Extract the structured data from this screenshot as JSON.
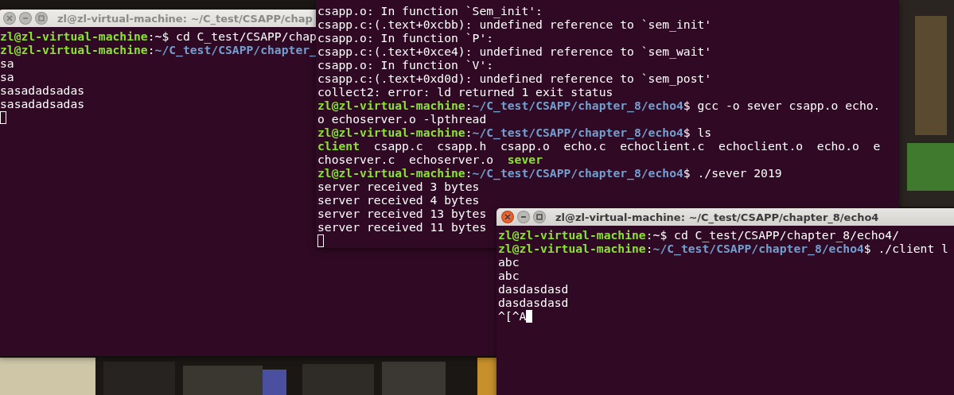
{
  "windows": [
    {
      "title": "zl@zl-virtual-machine: ~/C_test/CSAPP/chap",
      "focused": false,
      "lines": [
        {
          "kind": "output",
          "segments": [
            {
              "kind": "host",
              "text": "zl@zl-virtual-machine"
            },
            {
              "kind": "text",
              "text": ":~$ cd C_test/CSAPP/chap"
            }
          ]
        },
        {
          "kind": "output",
          "segments": [
            {
              "kind": "host",
              "text": "zl@zl-virtual-machine"
            },
            {
              "kind": "text",
              "text": ":"
            },
            {
              "kind": "path",
              "text": "~/C_test/CSAPP/chapter_"
            }
          ]
        },
        {
          "kind": "output",
          "segments": [
            {
              "kind": "text",
              "text": "sa"
            }
          ]
        },
        {
          "kind": "output",
          "segments": [
            {
              "kind": "text",
              "text": "sa"
            }
          ]
        },
        {
          "kind": "output",
          "segments": [
            {
              "kind": "text",
              "text": "sasadadsadas"
            }
          ]
        },
        {
          "kind": "output",
          "segments": [
            {
              "kind": "text",
              "text": "sasadadsadas"
            }
          ]
        },
        {
          "kind": "input"
        }
      ]
    },
    {
      "focused": false,
      "lines": [
        {
          "kind": "output",
          "segments": [
            {
              "kind": "text",
              "text": "csapp.o: In function `Sem_init':"
            }
          ]
        },
        {
          "kind": "output",
          "segments": [
            {
              "kind": "text",
              "text": "csapp.c:(.text+0xcbb): undefined reference to `sem_init'"
            }
          ]
        },
        {
          "kind": "output",
          "segments": [
            {
              "kind": "text",
              "text": "csapp.o: In function `P':"
            }
          ]
        },
        {
          "kind": "output",
          "segments": [
            {
              "kind": "text",
              "text": "csapp.c:(.text+0xce4): undefined reference to `sem_wait'"
            }
          ]
        },
        {
          "kind": "output",
          "segments": [
            {
              "kind": "text",
              "text": "csapp.o: In function `V':"
            }
          ]
        },
        {
          "kind": "output",
          "segments": [
            {
              "kind": "text",
              "text": "csapp.c:(.text+0xd0d): undefined reference to `sem_post'"
            }
          ]
        },
        {
          "kind": "output",
          "segments": [
            {
              "kind": "text",
              "text": "collect2: error: ld returned 1 exit status"
            }
          ]
        },
        {
          "kind": "output",
          "segments": [
            {
              "kind": "host",
              "text": "zl@zl-virtual-machine"
            },
            {
              "kind": "text",
              "text": ":"
            },
            {
              "kind": "path",
              "text": "~/C_test/CSAPP/chapter_8/echo4"
            },
            {
              "kind": "text",
              "text": "$ gcc -o sever csapp.o echo."
            }
          ]
        },
        {
          "kind": "output",
          "segments": [
            {
              "kind": "text",
              "text": "o echoserver.o -lpthread"
            }
          ]
        },
        {
          "kind": "output",
          "segments": [
            {
              "kind": "host",
              "text": "zl@zl-virtual-machine"
            },
            {
              "kind": "text",
              "text": ":"
            },
            {
              "kind": "path",
              "text": "~/C_test/CSAPP/chapter_8/echo4"
            },
            {
              "kind": "text",
              "text": "$ ls"
            }
          ]
        },
        {
          "kind": "output",
          "segments": [
            {
              "kind": "exec",
              "text": "client"
            },
            {
              "kind": "text",
              "text": "  csapp.c  csapp.h  csapp.o  echo.c  echoclient.c  echoclient.o  echo.o  e"
            }
          ]
        },
        {
          "kind": "output",
          "segments": [
            {
              "kind": "text",
              "text": "choserver.c  echoserver.o  "
            },
            {
              "kind": "exec",
              "text": "sever"
            }
          ]
        },
        {
          "kind": "output",
          "segments": [
            {
              "kind": "host",
              "text": "zl@zl-virtual-machine"
            },
            {
              "kind": "text",
              "text": ":"
            },
            {
              "kind": "path",
              "text": "~/C_test/CSAPP/chapter_8/echo4"
            },
            {
              "kind": "text",
              "text": "$ ./sever 2019"
            }
          ]
        },
        {
          "kind": "output",
          "segments": [
            {
              "kind": "text",
              "text": "server received 3 bytes"
            }
          ]
        },
        {
          "kind": "output",
          "segments": [
            {
              "kind": "text",
              "text": "server received 4 bytes"
            }
          ]
        },
        {
          "kind": "output",
          "segments": [
            {
              "kind": "text",
              "text": "server received 13 bytes"
            }
          ]
        },
        {
          "kind": "output",
          "segments": [
            {
              "kind": "text",
              "text": "server received 11 bytes"
            }
          ]
        },
        {
          "kind": "input"
        }
      ]
    },
    {
      "title": "zl@zl-virtual-machine: ~/C_test/CSAPP/chapter_8/echo4",
      "focused": true,
      "lines": [
        {
          "kind": "output",
          "segments": [
            {
              "kind": "host",
              "text": "zl@zl-virtual-machine"
            },
            {
              "kind": "text",
              "text": ":~$ cd C_test/CSAPP/chapter_8/echo4/"
            }
          ]
        },
        {
          "kind": "output",
          "segments": [
            {
              "kind": "host",
              "text": "zl@zl-virtual-machine"
            },
            {
              "kind": "text",
              "text": ":"
            },
            {
              "kind": "path",
              "text": "~/C_test/CSAPP/chapter_8/echo4"
            },
            {
              "kind": "text",
              "text": "$ ./client l"
            }
          ]
        },
        {
          "kind": "output",
          "segments": [
            {
              "kind": "text",
              "text": "abc"
            }
          ]
        },
        {
          "kind": "output",
          "segments": [
            {
              "kind": "text",
              "text": "abc"
            }
          ]
        },
        {
          "kind": "output",
          "segments": [
            {
              "kind": "text",
              "text": "dasdasdasd"
            }
          ]
        },
        {
          "kind": "output",
          "segments": [
            {
              "kind": "text",
              "text": "dasdasdasd"
            }
          ]
        },
        {
          "kind": "input",
          "segments": [
            {
              "kind": "text",
              "text": "^[^A"
            }
          ]
        }
      ]
    }
  ]
}
